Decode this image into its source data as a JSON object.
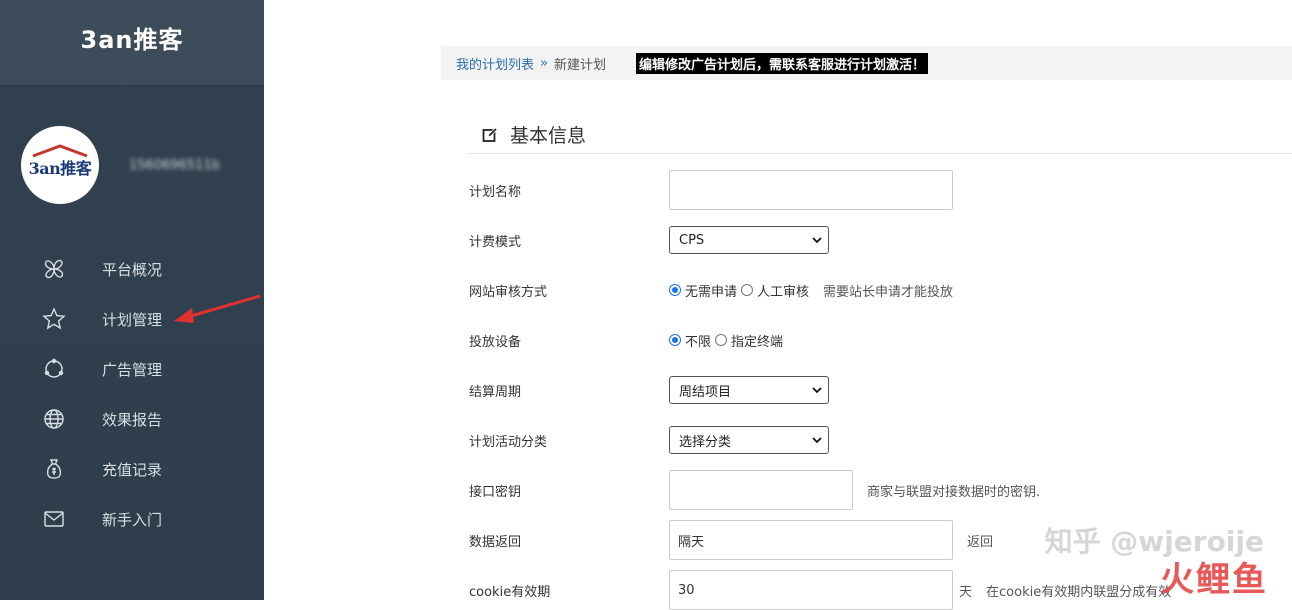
{
  "sidebar": {
    "brand": "3an推客",
    "avatar_logo": "3an推客",
    "username": "1560696511b",
    "items": [
      {
        "label": "平台概况",
        "icon": "clover-icon"
      },
      {
        "label": "计划管理",
        "icon": "star-icon"
      },
      {
        "label": "广告管理",
        "icon": "cycle-icon"
      },
      {
        "label": "效果报告",
        "icon": "globe-icon"
      },
      {
        "label": "充值记录",
        "icon": "money-bag-icon"
      },
      {
        "label": "新手入门",
        "icon": "mail-icon"
      }
    ]
  },
  "breadcrumb": {
    "link": "我的计划列表",
    "sep": "»",
    "current": "新建计划",
    "notice": "编辑修改广告计划后，需联系客服进行计划激活！"
  },
  "section": {
    "title": "基本信息"
  },
  "form": {
    "plan_name": {
      "label": "计划名称",
      "value": ""
    },
    "billing": {
      "label": "计费模式",
      "value": "CPS"
    },
    "review": {
      "label": "网站审核方式",
      "opt1": "无需申请",
      "opt2": "人工审核",
      "hint": "需要站长申请才能投放"
    },
    "device": {
      "label": "投放设备",
      "opt1": "不限",
      "opt2": "指定终端"
    },
    "settle": {
      "label": "结算周期",
      "value": "周结项目"
    },
    "category": {
      "label": "计划活动分类",
      "value": "选择分类"
    },
    "apikey": {
      "label": "接口密钥",
      "value": "",
      "hint": "商家与联盟对接数据时的密钥."
    },
    "return": {
      "label": "数据返回",
      "value": "隔天",
      "hint": "返回"
    },
    "cookie": {
      "label": "cookie有效期",
      "value": "30",
      "unit": "天",
      "hint": "在cookie有效期内联盟分成有效"
    }
  },
  "watermark": {
    "line1": "知乎 @wjeroije",
    "line2": "火鲤鱼"
  }
}
